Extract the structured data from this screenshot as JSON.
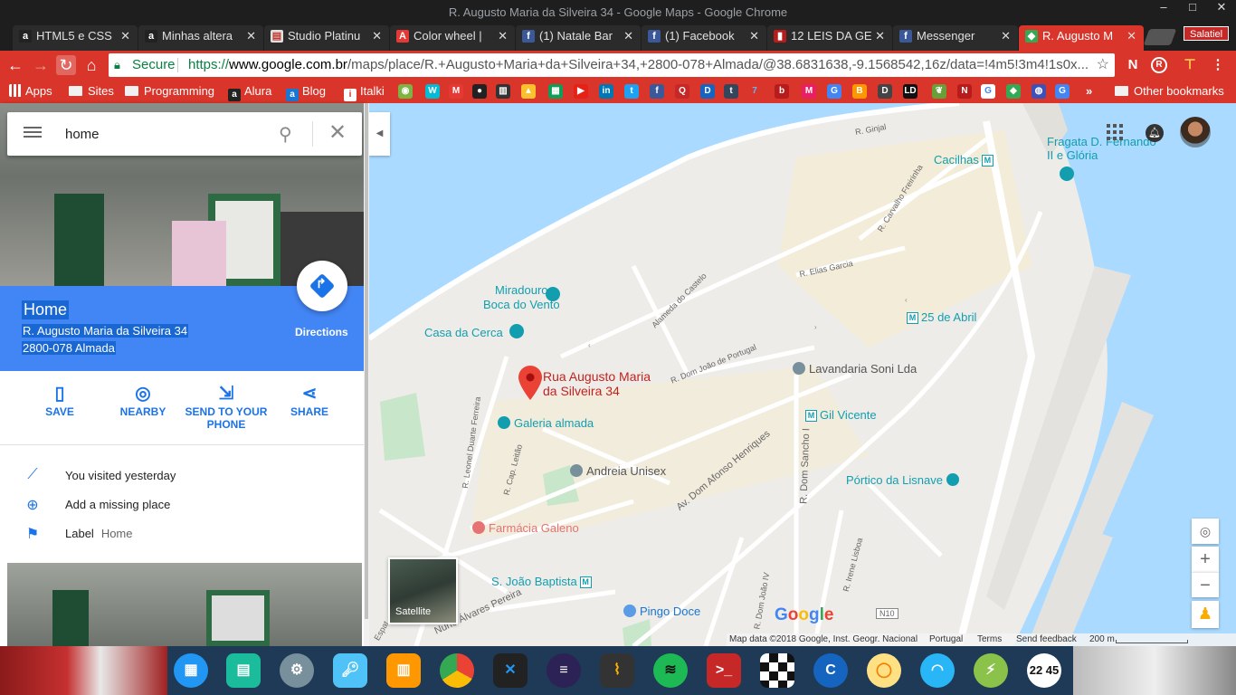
{
  "window": {
    "title": "R. Augusto Maria da Silveira 34 - Google Maps - Google Chrome",
    "controls": [
      "–",
      "□",
      "✕"
    ]
  },
  "tabs": [
    {
      "label": "HTML5 e CSS",
      "icon": "alura-icon",
      "color": "#222"
    },
    {
      "label": "Minhas altera",
      "icon": "alura-icon",
      "color": "#222"
    },
    {
      "label": "Studio Platinu",
      "icon": "page-icon",
      "color": "#c0392b"
    },
    {
      "label": "Color wheel |",
      "icon": "adobe-icon",
      "color": "#e53935"
    },
    {
      "label": "(1) Natale Bar",
      "icon": "facebook-icon",
      "color": "#3b5998"
    },
    {
      "label": "(1) Facebook",
      "icon": "facebook-icon",
      "color": "#3b5998"
    },
    {
      "label": "12 LEIS DA GE",
      "icon": "document-icon",
      "color": "#b71c1c"
    },
    {
      "label": "Messenger",
      "icon": "facebook-icon",
      "color": "#3b5998"
    },
    {
      "label": "R. Augusto M",
      "icon": "maps-icon",
      "color": "#34a853",
      "active": true
    }
  ],
  "profile_name": "Salatiel",
  "address_bar": {
    "secure_label": "Secure",
    "url_prefix": "https://",
    "url_host": "www.google.com.br",
    "url_path": "/maps/place/R.+Augusto+Maria+da+Silveira+34,+2800-078+Almada/@38.6831638,-9.1568542,16z/data=!4m5!3m4!1s0x..."
  },
  "bookmarks": {
    "apps": "Apps",
    "sites": "Sites",
    "programming": "Programming",
    "alura": "Alura",
    "blog": "Blog",
    "italki": "Italki",
    "other": "Other bookmarks"
  },
  "search": {
    "value": "home"
  },
  "place": {
    "title": "Home",
    "address_line1": "R. Augusto Maria da Silveira 34",
    "address_line2": "2800-078 Almada",
    "directions_label": "Directions"
  },
  "actions": {
    "save": "SAVE",
    "nearby": "NEARBY",
    "send_line1": "SEND TO YOUR",
    "send_line2": "PHONE",
    "share": "SHARE"
  },
  "info": {
    "visited": "You visited yesterday",
    "missing": "Add a missing place",
    "label": "Label",
    "label_value": "Home"
  },
  "map": {
    "pin_label_1": "Rua Augusto Maria",
    "pin_label_2": "da Silveira 34",
    "places": {
      "fragata_1": "Fragata D. Fernando",
      "fragata_2": "II e Glória",
      "cacilhas": "Cacilhas",
      "miradouro_1": "Miradouro",
      "miradouro_2": "Boca do Vento",
      "casa_cerca": "Casa da Cerca",
      "abril": "25 de Abril",
      "lavandaria": "Lavandaria Soni Lda",
      "galeria": "Galeria almada",
      "gil_vicente": "Gil Vicente",
      "andreia": "Andreia Unisex",
      "portico": "Pórtico da Lisnave",
      "farmacia": "Farmácia Galeno",
      "joao_baptista": "S. João Baptista",
      "pingo_doce": "Pingo Doce"
    },
    "roads": {
      "ginjal": "R. Ginjal",
      "carvalho": "R. Carvalho Freirinha",
      "elias": "R. Elias Garcia",
      "alameda": "Alameda do Castelo",
      "dom_joao": "R. Dom João de Portugal",
      "afonso": "Av. Dom Afonso Henriques",
      "sancho": "R. Dom Sancho I",
      "leonel": "R. Leonel Duarte Ferreira",
      "cap_leitao": "R. Cap. Leitão",
      "nuno": "Nuno Álvares Pereira",
      "dom_joao_iv": "R. Dom João IV",
      "irene": "R. Irene Lisboa",
      "n10": "N10",
      "espat": "Espat"
    },
    "satellite_label": "Satellite",
    "google_logo": "Google",
    "attribution": {
      "data": "Map data ©2018 Google, Inst. Geogr. Nacional",
      "country": "Portugal",
      "terms": "Terms",
      "feedback": "Send feedback",
      "scale": "200 m"
    }
  },
  "dock_time": "22 45",
  "colors": {
    "chrome_red": "#d9352b",
    "maps_blue": "#4285f4",
    "water": "#aadaff",
    "land": "#eeece8"
  }
}
